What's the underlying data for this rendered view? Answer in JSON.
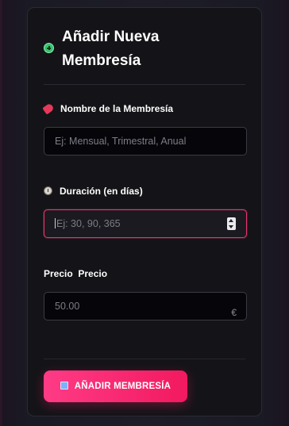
{
  "form": {
    "title": "Añadir Nueva Membresía",
    "fields": {
      "name": {
        "label": "Nombre de la Membresía",
        "placeholder": "Ej: Mensual, Trimestral, Anual"
      },
      "duration": {
        "label": "Duración (en días)",
        "placeholder": "Ej: 30, 90, 365"
      },
      "price": {
        "broken_image_alt": "Precio",
        "label": "Precio",
        "placeholder": "50.00",
        "currency": "€"
      }
    },
    "submit_label": "AÑADIR MEMBRESÍA"
  },
  "icons": {
    "title": "plus-circle-icon",
    "name": "tag-icon",
    "duration": "clock-icon",
    "submit": "floppy-disk-icon"
  },
  "colors": {
    "accent": "#f2195f",
    "focus_border": "#e8356a",
    "card_bg": "#141418",
    "page_bg": "#1e1d27"
  }
}
